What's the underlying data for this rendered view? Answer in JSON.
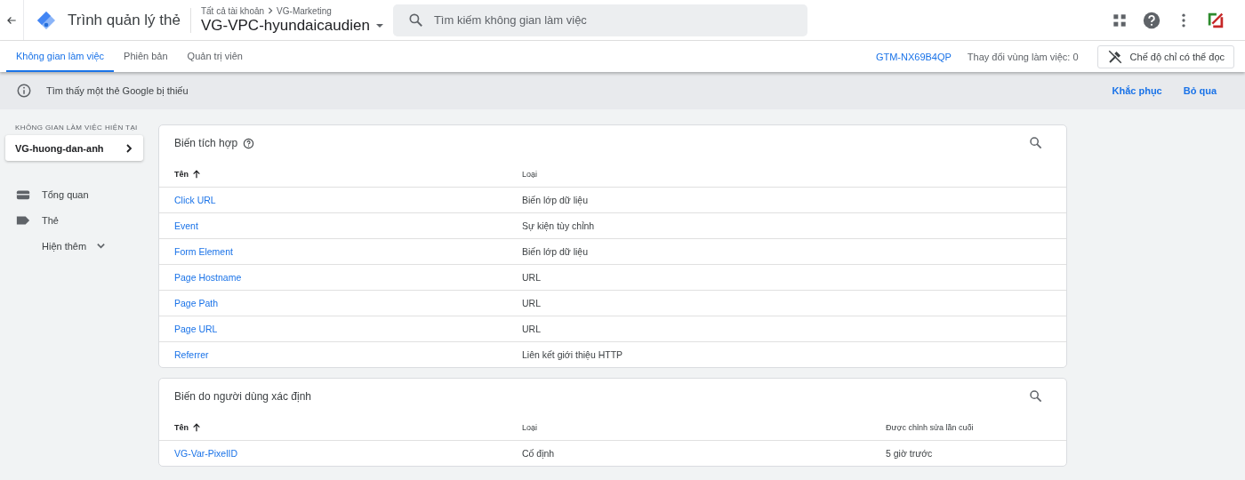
{
  "header": {
    "app_title": "Trình quản lý thẻ",
    "breadcrumb": [
      {
        "label": "Tất cả tài khoản"
      },
      {
        "label": "VG-Marketing"
      }
    ],
    "container_name": "VG-VPC-hyundaicaudien",
    "search": {
      "placeholder": "Tìm kiếm không gian làm việc"
    }
  },
  "tabs": [
    {
      "label": "Không gian làm việc",
      "selected": true
    },
    {
      "label": "Phiên bản",
      "selected": false
    },
    {
      "label": "Quản trị viên",
      "selected": false
    }
  ],
  "container_id": "GTM-NX69B4QP",
  "workspace_changes": "Thay đổi vùng làm việc: 0",
  "readonly_button": "Chế độ chỉ có thể đọc",
  "banner": {
    "message": "Tìm thấy một thẻ Google bị thiếu",
    "actions": [
      "Khắc phục",
      "Bỏ qua"
    ]
  },
  "sidebar": {
    "section_label": "KHÔNG GIAN LÀM VIỆC HIỆN TẠI",
    "workspace": "VG-huong-dan-anh",
    "items": [
      {
        "label": "Tổng quan",
        "kind": "overview"
      },
      {
        "label": "Thẻ",
        "kind": "tag"
      },
      {
        "label": "Hiện thêm",
        "kind": "more"
      }
    ]
  },
  "tables": [
    {
      "title": "Biến tích hợp",
      "help": true,
      "columns": [
        "Tên",
        "Loại"
      ],
      "rows": [
        [
          "Click URL",
          "Biến lớp dữ liệu"
        ],
        [
          "Event",
          "Sự kiện tùy chỉnh"
        ],
        [
          "Form Element",
          "Biến lớp dữ liệu"
        ],
        [
          "Page Hostname",
          "URL"
        ],
        [
          "Page Path",
          "URL"
        ],
        [
          "Page URL",
          "URL"
        ],
        [
          "Referrer",
          "Liên kết giới thiệu HTTP"
        ]
      ]
    },
    {
      "title": "Biến do người dùng xác định",
      "help": false,
      "columns": [
        "Tên",
        "Loại",
        "Được chỉnh sửa lần cuối"
      ],
      "rows": [
        [
          "VG-Var-PixelID",
          "Cố định",
          "5 giờ trước"
        ]
      ]
    }
  ]
}
